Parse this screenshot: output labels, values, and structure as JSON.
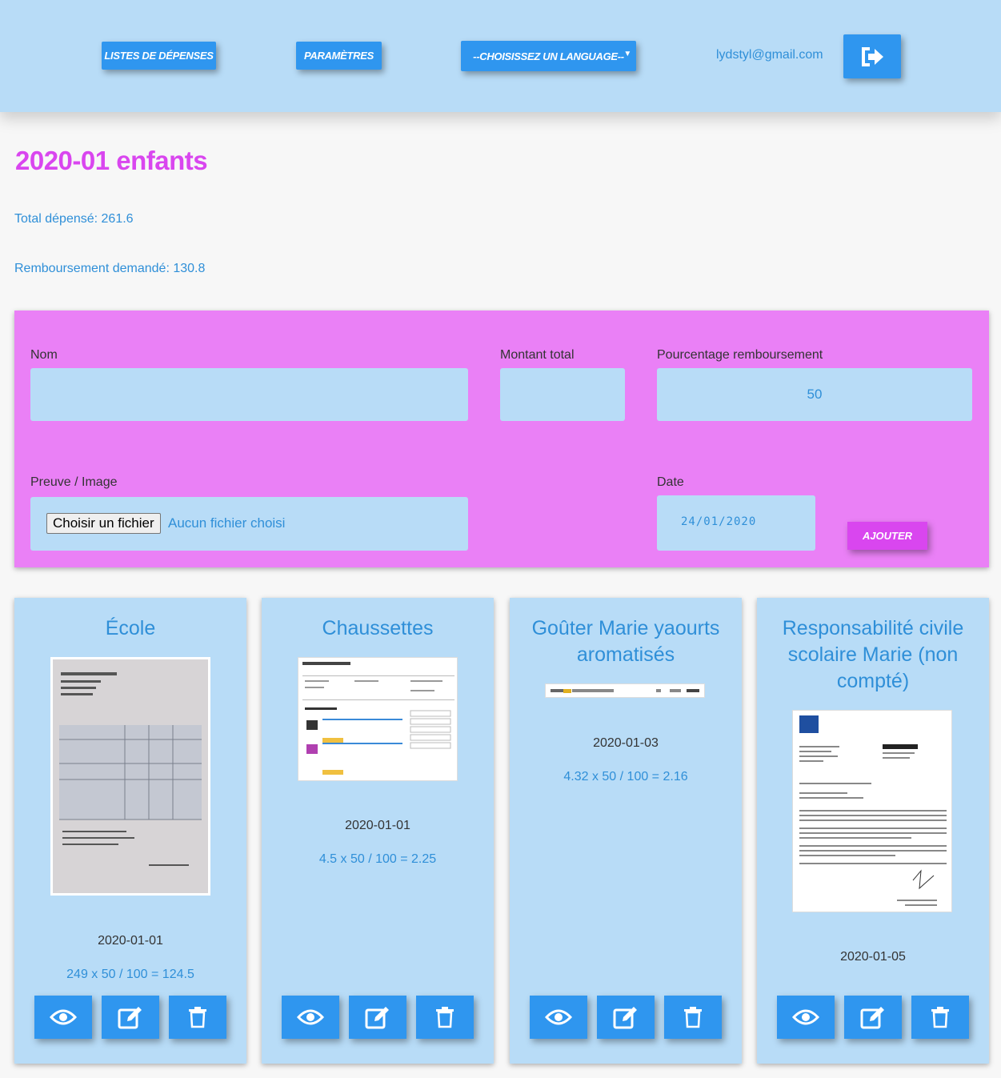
{
  "nav": {
    "lists_label": "Listes de dépenses",
    "params_label": "Paramètres",
    "lang_select": "--Choisissez un language--",
    "user_email": "lydstyl@gmail.com",
    "logout_icon": "sign-out-icon"
  },
  "page": {
    "title": "2020-01 enfants",
    "total": "Total dépensé: 261.6",
    "refund": "Remboursement demandé: 130.8"
  },
  "form": {
    "name_label": "Nom",
    "name_value": "",
    "amount_label": "Montant total",
    "amount_value": "",
    "percent_label": "Pourcentage remboursement",
    "percent_value": "50",
    "proof_label": "Preuve / Image",
    "file_button": "Choisir un fichier",
    "file_status": "Aucun fichier choisi",
    "date_label": "Date",
    "date_value": "24/01/2020",
    "add_button": "Ajouter"
  },
  "expenses": [
    {
      "title": "École",
      "date": "2020-01-01",
      "calc": "249 x 50 / 100 = 124.5"
    },
    {
      "title": "Chaussettes",
      "date": "2020-01-01",
      "calc": "4.5 x 50 / 100 = 2.25"
    },
    {
      "title": "Goûter Marie yaourts aromatisés",
      "date": "2020-01-03",
      "calc": "4.32 x 50 / 100 = 2.16"
    },
    {
      "title": "Responsabilité civile scolaire Marie (non compté)",
      "date": "2020-01-05",
      "calc": ""
    }
  ],
  "colors": {
    "header_bg": "#b8dcf7",
    "primary": "#2f96ef",
    "accent": "#d946ef",
    "form_bg": "#ea80f6"
  }
}
